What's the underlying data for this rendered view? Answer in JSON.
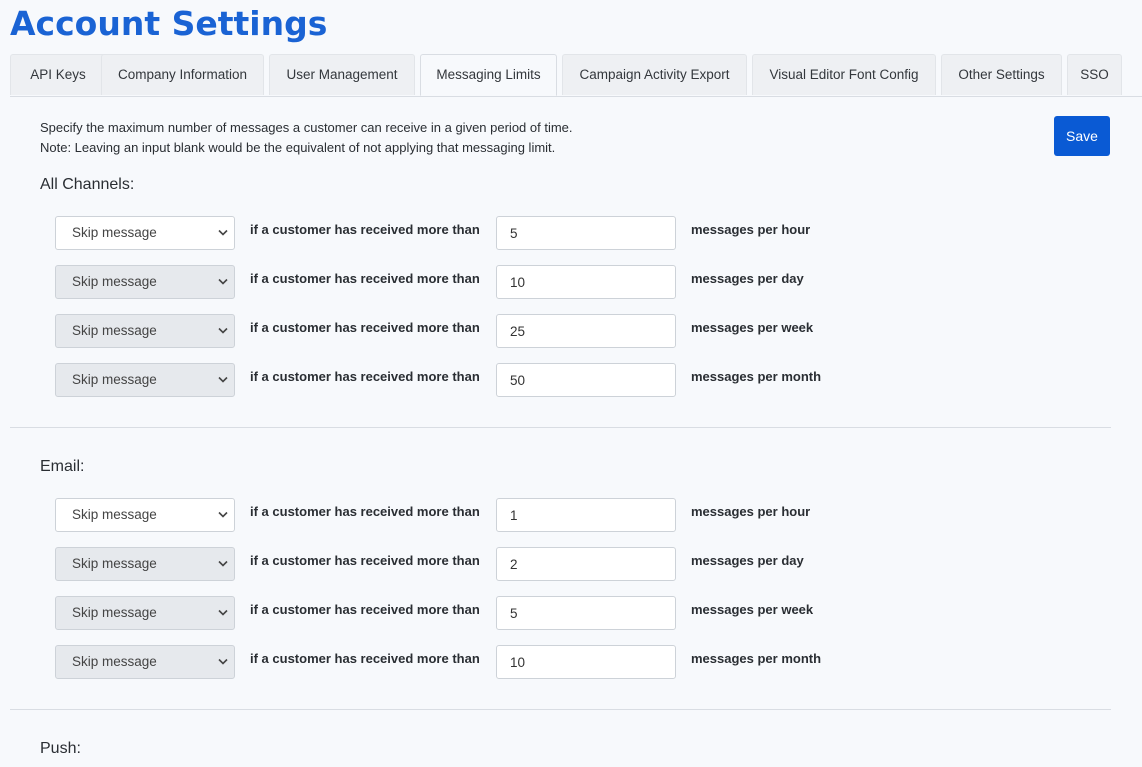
{
  "page": {
    "title": "Account Settings"
  },
  "tabs": [
    {
      "label": "API Keys"
    },
    {
      "label": "Company Information"
    },
    {
      "label": "User Management"
    },
    {
      "label": "Messaging Limits",
      "active": true
    },
    {
      "label": "Campaign Activity Export"
    },
    {
      "label": "Visual Editor Font Config"
    },
    {
      "label": "Other Settings"
    },
    {
      "label": "SSO"
    }
  ],
  "intro": {
    "line1": "Specify the maximum number of messages a customer can receive in a given period of time.",
    "line2": "Note: Leaving an input blank would be the equivalent of not applying that messaging limit."
  },
  "save_label": "Save",
  "sections": [
    {
      "title": "All Channels:",
      "rows": [
        {
          "action": "Skip message",
          "condition": "if a customer has received more than",
          "value": "5",
          "period": "messages per hour"
        },
        {
          "action": "Skip message",
          "condition": "if a customer has received more than",
          "value": "10",
          "period": "messages per day"
        },
        {
          "action": "Skip message",
          "condition": "if a customer has received more than",
          "value": "25",
          "period": "messages per week"
        },
        {
          "action": "Skip message",
          "condition": "if a customer has received more than",
          "value": "50",
          "period": "messages per month"
        }
      ]
    },
    {
      "title": "Email:",
      "rows": [
        {
          "action": "Skip message",
          "condition": "if a customer has received more than",
          "value": "1",
          "period": "messages per hour"
        },
        {
          "action": "Skip message",
          "condition": "if a customer has received more than",
          "value": "2",
          "period": "messages per day"
        },
        {
          "action": "Skip message",
          "condition": "if a customer has received more than",
          "value": "5",
          "period": "messages per week"
        },
        {
          "action": "Skip message",
          "condition": "if a customer has received more than",
          "value": "10",
          "period": "messages per month"
        }
      ]
    },
    {
      "title": "Push:",
      "rows": []
    }
  ],
  "colors": {
    "accent": "#1a63d4",
    "button": "#0a5ad4"
  },
  "icons": {
    "select_arrow": "chevron-down-icon"
  }
}
